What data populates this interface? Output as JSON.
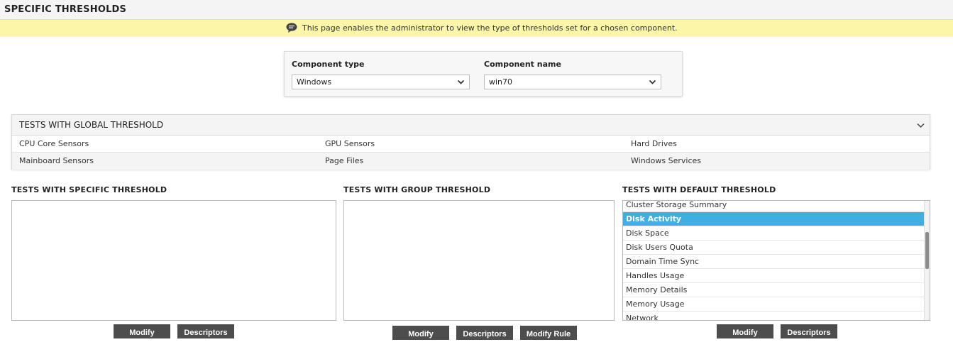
{
  "header": {
    "title": "SPECIFIC THRESHOLDS"
  },
  "info": {
    "icon": "speech-bubble-icon",
    "text": "This page enables the administrator to view the type of thresholds set for a chosen component."
  },
  "selectors": {
    "component_type": {
      "label": "Component type",
      "value": "Windows"
    },
    "component_name": {
      "label": "Component name",
      "value": "win70"
    }
  },
  "global": {
    "title": "TESTS WITH GLOBAL THRESHOLD",
    "rows": [
      [
        "CPU Core Sensors",
        "GPU Sensors",
        "Hard Drives"
      ],
      [
        "Mainboard Sensors",
        "Page Files",
        "Windows Services"
      ]
    ]
  },
  "specific": {
    "title": "TESTS WITH SPECIFIC THRESHOLD",
    "modify_label": "Modify",
    "descriptors_label": "Descriptors"
  },
  "group": {
    "title": "TESTS WITH GROUP THRESHOLD",
    "modify_label": "Modify",
    "descriptors_label": "Descriptors",
    "modify_rule_label": "Modify Rule"
  },
  "default": {
    "title": "TESTS WITH DEFAULT THRESHOLD",
    "items": [
      "Cluster Storage Summary",
      "Disk Activity",
      "Disk Space",
      "Disk Users Quota",
      "Domain Time Sync",
      "Handles Usage",
      "Memory Details",
      "Memory Usage",
      "Network"
    ],
    "selected": "Disk Activity",
    "modify_label": "Modify",
    "descriptors_label": "Descriptors"
  },
  "colors": {
    "selected_row": "#3faee0",
    "info_bar": "#fbf6a8",
    "button": "#4d4d4d"
  }
}
